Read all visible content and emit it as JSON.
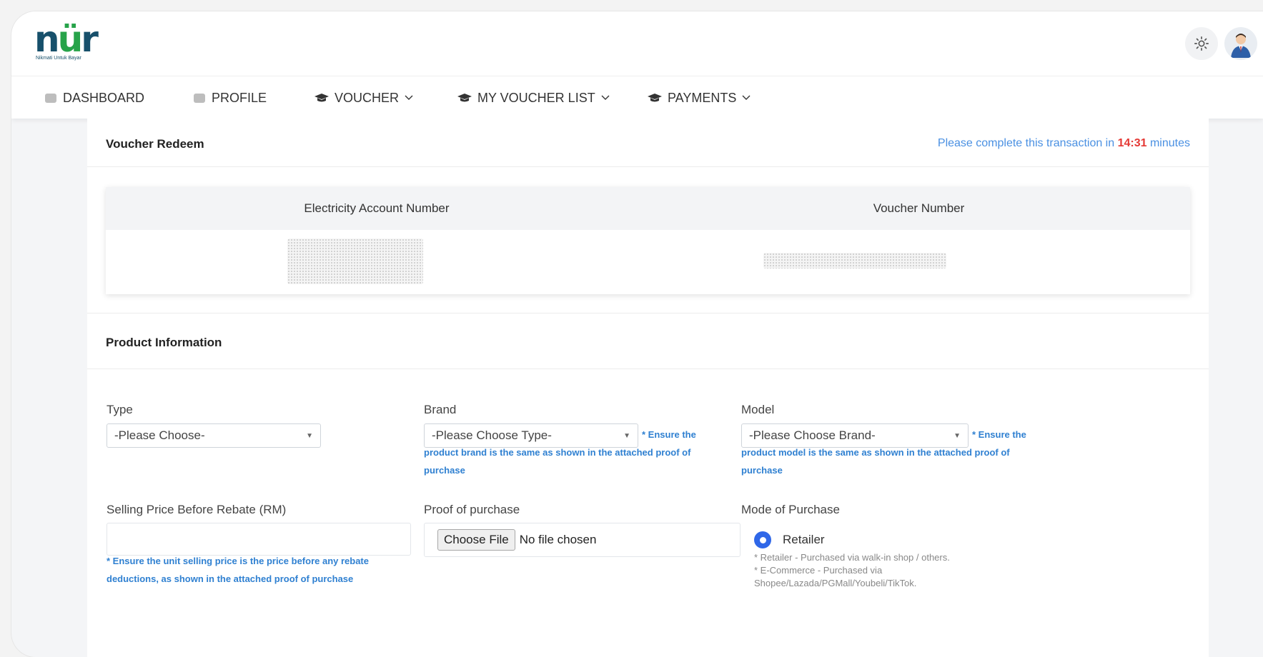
{
  "logo": {
    "word_left": "n",
    "word_mid": "ü",
    "word_right": "r",
    "tagline": "Nikmati Untuk Bayar"
  },
  "nav": {
    "items": [
      {
        "label": "DASHBOARD",
        "icon": "home-icon"
      },
      {
        "label": "PROFILE",
        "icon": "user-icon"
      },
      {
        "label": "VOUCHER",
        "icon": "graduation-cap-icon",
        "dropdown": true
      },
      {
        "label": "MY VOUCHER LIST",
        "icon": "graduation-cap-icon",
        "dropdown": true
      },
      {
        "label": "PAYMENTS",
        "icon": "graduation-cap-icon",
        "dropdown": true
      }
    ]
  },
  "redeem": {
    "title": "Voucher Redeem",
    "timer_prefix": "Please complete this transaction in",
    "timer_value": "14:31",
    "timer_suffix": "minutes",
    "columns": {
      "account": "Electricity Account Number",
      "voucher": "Voucher Number"
    }
  },
  "product": {
    "title": "Product Information",
    "type": {
      "label": "Type",
      "value": "-Please Choose-"
    },
    "brand": {
      "label": "Brand",
      "value": "-Please Choose Type-",
      "hint": "* Ensure the product brand is the same as shown in the attached proof of purchase"
    },
    "model": {
      "label": "Model",
      "value": "-Please Choose Brand-",
      "hint": "* Ensure the product model is the same as shown in the attached proof of purchase"
    },
    "price": {
      "label": "Selling Price Before Rebate (RM)",
      "value": "",
      "hint": "* Ensure the unit selling price is the price before any rebate deductions, as shown in the attached proof of purchase"
    },
    "proof": {
      "label": "Proof of purchase",
      "button": "Choose File",
      "status": "No file chosen"
    },
    "mode": {
      "label": "Mode of Purchase",
      "option": "Retailer",
      "note_retailer": "* Retailer - Purchased via walk-in shop / others.",
      "note_ecommerce": "* E-Commerce - Purchased via Shopee/Lazada/PGMall/Youbeli/TikTok."
    }
  },
  "colors": {
    "accent": "#2f67e8",
    "hint": "#2f80d1",
    "timer": "#4a90e2",
    "timer_value": "#e53935"
  }
}
